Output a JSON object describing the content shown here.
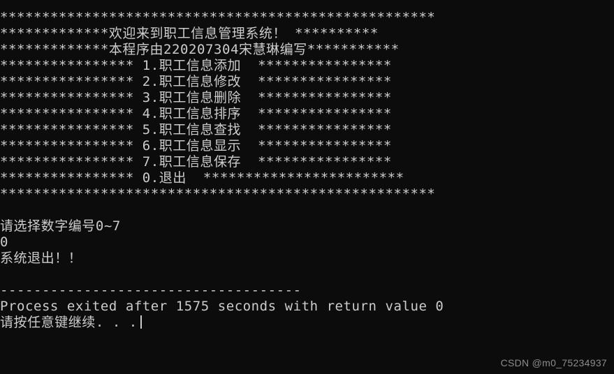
{
  "window": {
    "type": "console-terminal",
    "background_color": "#0c0c0c",
    "text_color": "#cccccc",
    "watermark_color": "#8c8c8c"
  },
  "console": {
    "lines": [
      "****************************************************",
      "*************欢迎来到职工信息管理系统！ **********",
      "*************本程序由220207304宋慧琳编写***********",
      "**************** 1.职工信息添加  ****************",
      "**************** 2.职工信息修改  ****************",
      "**************** 3.职工信息删除  ****************",
      "**************** 4.职工信息排序  ****************",
      "**************** 5.职工信息查找  ****************",
      "**************** 6.职工信息显示  ****************",
      "**************** 7.职工信息保存  ****************",
      "**************** 0.退出  ************************",
      "****************************************************",
      "",
      "请选择数字编号0~7",
      "0",
      "系统退出！！",
      "",
      "------------------------------------",
      "Process exited after 1575 seconds with return value 0",
      "请按任意键继续. . ."
    ],
    "prompt_text": "请选择数字编号0~7",
    "user_input": "0",
    "exit_message": "系统退出！！",
    "separator": "------------------------------------",
    "process_exit_line": "Process exited after 1575 seconds with return value 0",
    "process_exit_seconds": "1575",
    "process_return_value": "0",
    "press_any_key": "请按任意键继续. . .",
    "menu_items": [
      {
        "number": "1",
        "label": "职工信息添加"
      },
      {
        "number": "2",
        "label": "职工信息修改"
      },
      {
        "number": "3",
        "label": "职工信息删除"
      },
      {
        "number": "4",
        "label": "职工信息排序"
      },
      {
        "number": "5",
        "label": "职工信息查找"
      },
      {
        "number": "6",
        "label": "职工信息显示"
      },
      {
        "number": "7",
        "label": "职工信息保存"
      },
      {
        "number": "0",
        "label": "退出"
      }
    ],
    "title_banner": "欢迎来到职工信息管理系统！",
    "author_banner": "本程序由220207304宋慧琳编写"
  },
  "watermark": {
    "text": "CSDN @m0_75234937"
  }
}
